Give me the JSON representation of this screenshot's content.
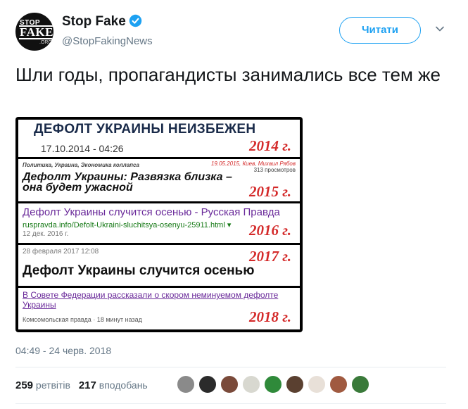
{
  "account": {
    "name": "Stop Fake",
    "handle": "@StopFakingNews",
    "avatar": {
      "line1": "STOP",
      "line2": "FAKE",
      "line3": ".ORG"
    }
  },
  "follow_button": {
    "label": "Читати"
  },
  "tweet": {
    "text": "Шли годы, пропагандисты занимались все тем же"
  },
  "image": {
    "panels": [
      {
        "headline": "ДЕФОЛТ УКРАИНЫ НЕИЗБЕЖЕН",
        "date": "17.10.2014 - 04:26",
        "year": "2014 г."
      },
      {
        "categories": "Политика, Украина, Экономика коллапса",
        "meta": "19.05.2015, Киев, Михаил Рябов",
        "views": "313 просмотров",
        "headline": "Дефолт Украины: Развязка близка – она будет ужасной",
        "year": "2015 г."
      },
      {
        "link": "Дефолт Украины случится осенью - Русская Правда",
        "url": "ruspravda.info/Defolt-Ukraini-sluchitsya-osenyu-25911.html ▾",
        "date": "12 дек. 2016 г.",
        "year": "2016 г."
      },
      {
        "date": "28 февраля 2017 12:08",
        "headline": "Дефолт Украины случится осенью",
        "year": "2017 г."
      },
      {
        "link": "В Совете Федерации рассказали о скором неминуемом дефолте Украины",
        "source": "Комсомольская правда · 18 минут назад",
        "year": "2018 г."
      }
    ]
  },
  "timestamp": "04:49 - 24 черв. 2018",
  "stats": {
    "retweets_count": "259",
    "retweets_label": "ретвітів",
    "likes_count": "217",
    "likes_label": "вподобань"
  },
  "likers": [
    {
      "name": "liker-1",
      "color": "#8a8a8a"
    },
    {
      "name": "liker-2",
      "color": "#2b2b2b"
    },
    {
      "name": "liker-3",
      "color": "#7a4a3a"
    },
    {
      "name": "liker-4",
      "color": "#d8d8d0"
    },
    {
      "name": "liker-5",
      "color": "#2f8a3a"
    },
    {
      "name": "liker-6",
      "color": "#5a4030"
    },
    {
      "name": "liker-7",
      "color": "#e8e0d8"
    },
    {
      "name": "liker-8",
      "color": "#a05a40"
    },
    {
      "name": "liker-9",
      "color": "#3a7a3a"
    }
  ],
  "colors": {
    "accent": "#1da1f2",
    "text": "#14171a",
    "muted": "#657786",
    "year_red": "#d42a2a"
  }
}
